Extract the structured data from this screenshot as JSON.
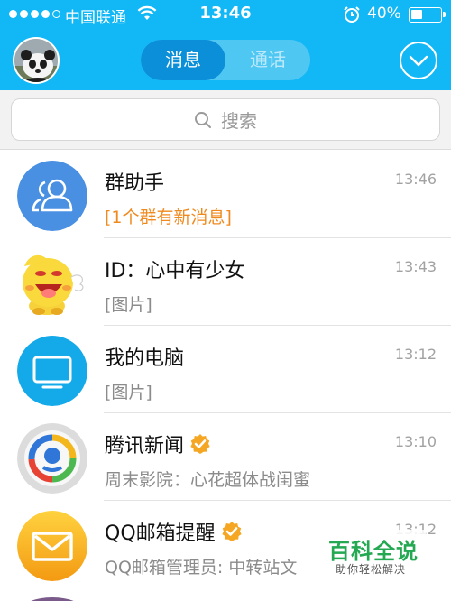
{
  "status_bar": {
    "carrier": "中国联通",
    "time": "13:46",
    "battery_text": "40%",
    "battery_level": 0.4,
    "signal_bars": 4,
    "signal_total": 5
  },
  "header": {
    "tabs": [
      {
        "label": "消息",
        "active": true
      },
      {
        "label": "通话",
        "active": false
      }
    ]
  },
  "search": {
    "placeholder": "搜索"
  },
  "conversations": [
    {
      "name": "群助手",
      "time": "13:46",
      "preview": "[1个群有新消息]",
      "verified": false,
      "icon": "group-assistant-icon"
    },
    {
      "name": "ID：心中有少女",
      "time": "13:43",
      "preview": "[图片]",
      "verified": false,
      "icon": "cartoon-avatar"
    },
    {
      "name": "我的电脑",
      "time": "13:12",
      "preview": "[图片]",
      "verified": false,
      "icon": "computer-icon"
    },
    {
      "name": "腾讯新闻",
      "time": "13:10",
      "preview": "周末影院：心花超体战闺蜜",
      "verified": true,
      "icon": "tencent-news-logo"
    },
    {
      "name": "QQ邮箱提醒",
      "time": "13:12",
      "preview": "QQ邮箱管理员: 中转站文",
      "verified": true,
      "icon": "mail-icon"
    }
  ],
  "watermark": {
    "title": "百科全说",
    "subtitle": "助你轻松解决"
  },
  "colors": {
    "header_blue": "#12b7f5",
    "tab_active": "#0a8fd8",
    "highlight_orange": "#ef8a1f",
    "verified_orange": "#f5a623",
    "watermark_green": "#24a852"
  }
}
